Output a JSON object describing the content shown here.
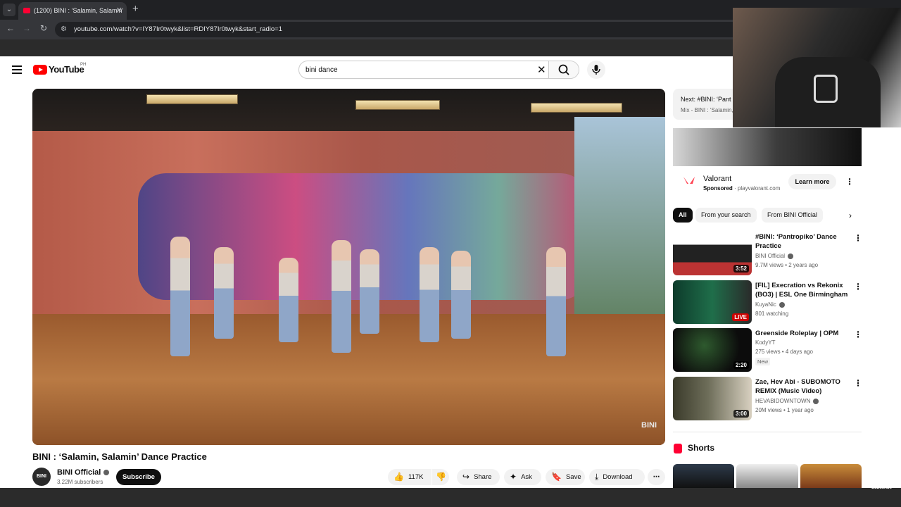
{
  "browser": {
    "tab_title": "(1200) BINI : ‘Salamin, Salamin’",
    "url": "youtube.com/watch?v=IY87Ir0twyk&list=RDIY87Ir0twyk&start_radio=1"
  },
  "header": {
    "logo_text": "YouTube",
    "country_code": "PH",
    "search_value": "bini dance"
  },
  "player": {
    "watermark": "BINI"
  },
  "video": {
    "title": "BINI : ‘Salamin, Salamin’ Dance Practice",
    "channel_name": "BINI Official",
    "channel_avatar": "BINI",
    "subscribers": "3.22M subscribers",
    "subscribe_label": "Subscribe",
    "likes": "117K",
    "share_label": "Share",
    "ask_label": "Ask",
    "save_label": "Save",
    "download_label": "Download"
  },
  "sidebar": {
    "next": {
      "label": "Next: #BINI: ‘Pant",
      "sub": "Mix - BINI : ‘Salamin,"
    },
    "ad": {
      "title": "Valorant",
      "sponsored": "Sponsored",
      "domain": "playvalorant.com",
      "cta": "Learn more",
      "brand_color": "#ff4655"
    },
    "chips": [
      "All",
      "From your search",
      "From BINI Official"
    ],
    "recommendations": [
      {
        "title": "#BINI: ‘Pantropiko’ Dance Practice",
        "channel": "BINI Official",
        "verified": true,
        "meta": "9.7M views • 2 years ago",
        "duration": "3:52"
      },
      {
        "title": "[FIL] Execration vs Rekonix (BO3) | ESL One Birmingham ...",
        "channel": "KuyaNic",
        "verified": true,
        "meta": "801 watching",
        "duration": "LIVE"
      },
      {
        "title": "Greenside Roleplay | OPM",
        "channel": "KodyYT",
        "verified": false,
        "meta": "275 views • 4 days ago",
        "badge": "New",
        "duration": "2:20"
      },
      {
        "title": "Zae, Hev Abi - SUBOMOTO REMIX (Music Video)",
        "channel": "HEVABIDOWNTOWN",
        "verified": true,
        "meta": "20M views • 1 year ago",
        "duration": "3:00"
      }
    ],
    "shorts_title": "Shorts"
  },
  "overlay": {
    "subscribe_watermark": "Subscribe"
  }
}
